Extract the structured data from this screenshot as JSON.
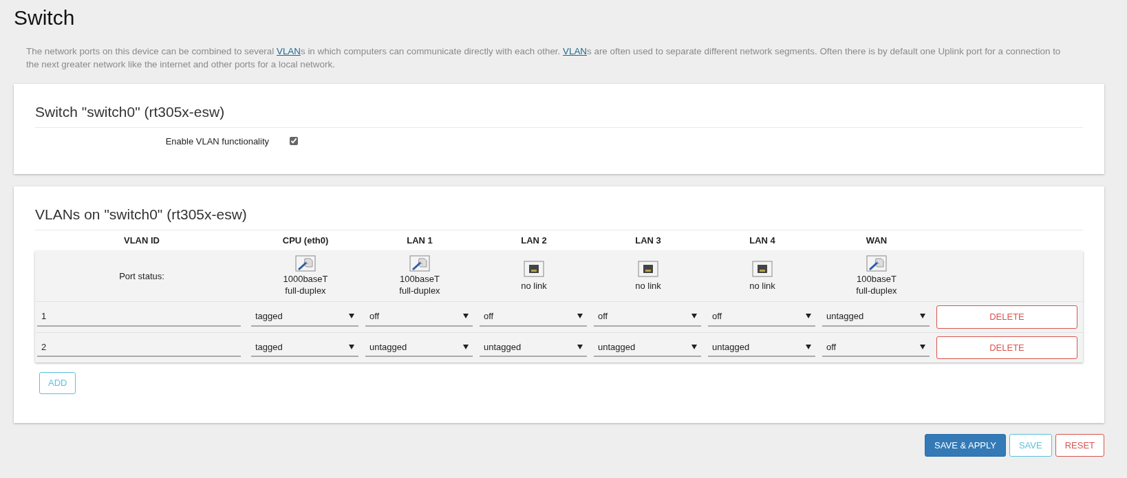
{
  "page_title": "Switch",
  "description": [
    {
      "text": "The network ports on this device can be combined to several ",
      "link": false
    },
    {
      "text": "VLAN",
      "link": true
    },
    {
      "text": "s in which computers can communicate directly with each other. ",
      "link": false
    },
    {
      "text": "VLAN",
      "link": true
    },
    {
      "text": "s are often used to separate different network segments. Often there is by default one Uplink port for a connection to the next greater network like the internet and other ports for a local network.",
      "link": false
    }
  ],
  "switch_section": {
    "title": "Switch \"switch0\" (rt305x-esw)",
    "enable_label": "Enable VLAN functionality",
    "enable_checked": true
  },
  "vlan_section": {
    "title": "VLANs on \"switch0\" (rt305x-esw)",
    "id_column": "VLAN ID",
    "port_status_label": "Port status:",
    "ports": [
      {
        "name": "CPU (eth0)",
        "link": true,
        "status": [
          "1000baseT",
          "full-duplex"
        ]
      },
      {
        "name": "LAN 1",
        "link": true,
        "status": [
          "100baseT",
          "full-duplex"
        ]
      },
      {
        "name": "LAN 2",
        "link": false,
        "status": [
          "no link"
        ]
      },
      {
        "name": "LAN 3",
        "link": false,
        "status": [
          "no link"
        ]
      },
      {
        "name": "LAN 4",
        "link": false,
        "status": [
          "no link"
        ]
      },
      {
        "name": "WAN",
        "link": true,
        "status": [
          "100baseT",
          "full-duplex"
        ]
      }
    ],
    "rows": [
      {
        "id": "1",
        "values": [
          "tagged",
          "off",
          "off",
          "off",
          "off",
          "untagged"
        ],
        "delete": "DELETE"
      },
      {
        "id": "2",
        "values": [
          "tagged",
          "untagged",
          "untagged",
          "untagged",
          "untagged",
          "off"
        ],
        "delete": "DELETE"
      }
    ],
    "add": "ADD"
  },
  "actions": [
    {
      "label": "SAVE & APPLY",
      "kind": "primary"
    },
    {
      "label": "SAVE",
      "kind": "info"
    },
    {
      "label": "RESET",
      "kind": "danger"
    }
  ]
}
